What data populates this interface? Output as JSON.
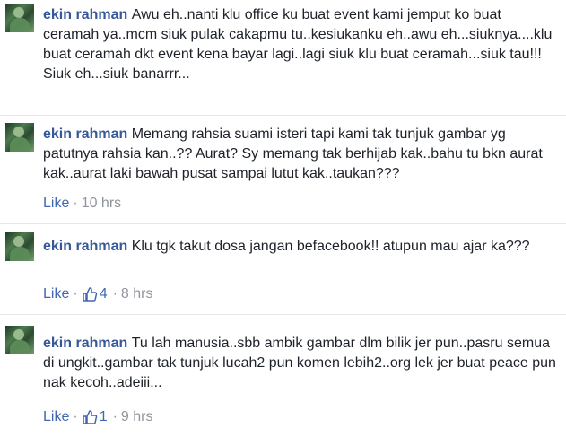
{
  "comments": [
    {
      "author": "ekin rahman",
      "text": "Awu eh..nanti klu office ku buat event kami jemput ko buat ceramah ya..mcm siuk pulak cakapmu tu..kesiukanku eh..awu eh...siuknya....klu buat ceramah dkt event kena bayar lagi..lagi siuk klu buat ceramah...siuk tau!!! Siuk eh...siuk banarrr..."
    },
    {
      "author": "ekin rahman",
      "text": "Memang rahsia suami isteri tapi kami tak tunjuk gambar yg patutnya rahsia kan..?? Aurat? Sy memang tak berhijab kak..bahu tu bkn aurat kak..aurat laki bawah pusat sampai lutut kak..taukan???",
      "like_label": "Like",
      "time": "10 hrs"
    },
    {
      "author": "ekin rahman",
      "text": "Klu tgk takut dosa jangan befacebook!! atupun mau ajar ka???",
      "like_label": "Like",
      "likes": "4",
      "time": "8 hrs"
    },
    {
      "author": "ekin rahman",
      "text": "Tu lah manusia..sbb ambik gambar dlm bilik jer pun..pasru semua di ungkit..gambar tak tunjuk lucah2 pun komen lebih2..org lek jer buat peace pun nak kecoh..adeiii...",
      "like_label": "Like",
      "likes": "1",
      "time": "9 hrs"
    }
  ],
  "separator": "·",
  "colors": {
    "author": "#365899",
    "text": "#1d2129",
    "meta": "#90949c",
    "like": "#4267b2"
  },
  "icons": {
    "like": "thumbs-up-icon",
    "avatar": "profile-avatar"
  }
}
